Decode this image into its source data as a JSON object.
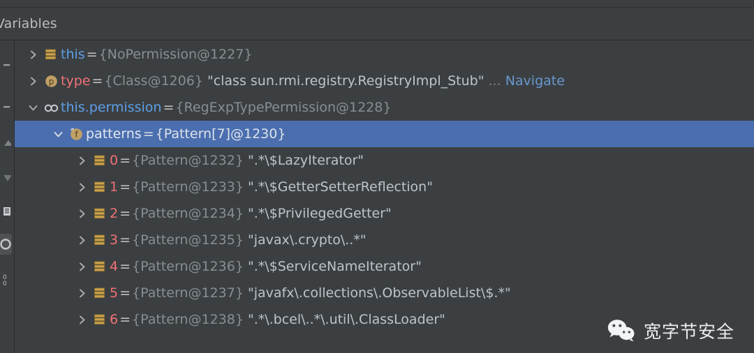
{
  "panel": {
    "tab_label": "Variables"
  },
  "gutter": {
    "icons": [
      {
        "name": "minus-icon"
      },
      {
        "name": "minus-icon"
      },
      {
        "name": "step-up-icon"
      },
      {
        "name": "step-down-icon"
      },
      {
        "name": "list-icon"
      },
      {
        "name": "evaluate-icon"
      },
      {
        "name": "binary-icon"
      }
    ]
  },
  "colors": {
    "background": "#3c3f41",
    "selection": "#4b6eaf",
    "name_blue": "#5c9fe8",
    "name_red": "#f07178",
    "meta_gray": "#888e92",
    "value_text": "#bcc5cc",
    "link_blue": "#6897d0",
    "icon_gold": "#c9a24c"
  },
  "tree": {
    "rows": [
      {
        "indent": 1,
        "expander": "collapsed",
        "icon": "object-array-icon",
        "name": "this",
        "name_color": "blue",
        "eq": "=",
        "meta": "{NoPermission@1227}",
        "value": "",
        "ellipsis": "",
        "link": "",
        "selected": false
      },
      {
        "indent": 1,
        "expander": "collapsed",
        "icon": "parameter-icon",
        "name": "type",
        "name_color": "red",
        "eq": "=",
        "meta": "{Class@1206}",
        "value": "\"class sun.rmi.registry.RegistryImpl_Stub\"",
        "ellipsis": "...",
        "link": "Navigate",
        "selected": false
      },
      {
        "indent": 1,
        "expander": "expanded",
        "icon": "watch-glasses-icon",
        "name": "this.permission",
        "name_color": "blue",
        "eq": "=",
        "meta": "{RegExpTypePermission@1228}",
        "value": "",
        "ellipsis": "",
        "link": "",
        "selected": false
      },
      {
        "indent": 3,
        "expander": "expanded",
        "icon": "field-icon",
        "name": "patterns",
        "name_color": "sel",
        "eq": "=",
        "meta": "{Pattern[7]@1230}",
        "value": "",
        "ellipsis": "",
        "link": "",
        "selected": true
      },
      {
        "indent": 4,
        "expander": "collapsed",
        "icon": "object-array-icon",
        "name": "0",
        "name_color": "idx",
        "eq": "=",
        "meta": "{Pattern@1232}",
        "value": "\".*\\$LazyIterator\"",
        "ellipsis": "",
        "link": "",
        "selected": false
      },
      {
        "indent": 4,
        "expander": "collapsed",
        "icon": "object-array-icon",
        "name": "1",
        "name_color": "idx",
        "eq": "=",
        "meta": "{Pattern@1233}",
        "value": "\".*\\$GetterSetterReflection\"",
        "ellipsis": "",
        "link": "",
        "selected": false
      },
      {
        "indent": 4,
        "expander": "collapsed",
        "icon": "object-array-icon",
        "name": "2",
        "name_color": "idx",
        "eq": "=",
        "meta": "{Pattern@1234}",
        "value": "\".*\\$PrivilegedGetter\"",
        "ellipsis": "",
        "link": "",
        "selected": false
      },
      {
        "indent": 4,
        "expander": "collapsed",
        "icon": "object-array-icon",
        "name": "3",
        "name_color": "idx",
        "eq": "=",
        "meta": "{Pattern@1235}",
        "value": "\"javax\\.crypto\\..*\"",
        "ellipsis": "",
        "link": "",
        "selected": false
      },
      {
        "indent": 4,
        "expander": "collapsed",
        "icon": "object-array-icon",
        "name": "4",
        "name_color": "idx",
        "eq": "=",
        "meta": "{Pattern@1236}",
        "value": "\".*\\$ServiceNameIterator\"",
        "ellipsis": "",
        "link": "",
        "selected": false
      },
      {
        "indent": 4,
        "expander": "collapsed",
        "icon": "object-array-icon",
        "name": "5",
        "name_color": "idx",
        "eq": "=",
        "meta": "{Pattern@1237}",
        "value": "\"javafx\\.collections\\.ObservableList\\$.*\"",
        "ellipsis": "",
        "link": "",
        "selected": false
      },
      {
        "indent": 4,
        "expander": "collapsed",
        "icon": "object-array-icon",
        "name": "6",
        "name_color": "idx",
        "eq": "=",
        "meta": "{Pattern@1238}",
        "value": "\".*\\.bcel\\..*\\.util\\.ClassLoader\"",
        "ellipsis": "",
        "link": "",
        "selected": false
      }
    ]
  },
  "watermark": {
    "logo": "wechat-icon",
    "text": "宽字节安全"
  }
}
